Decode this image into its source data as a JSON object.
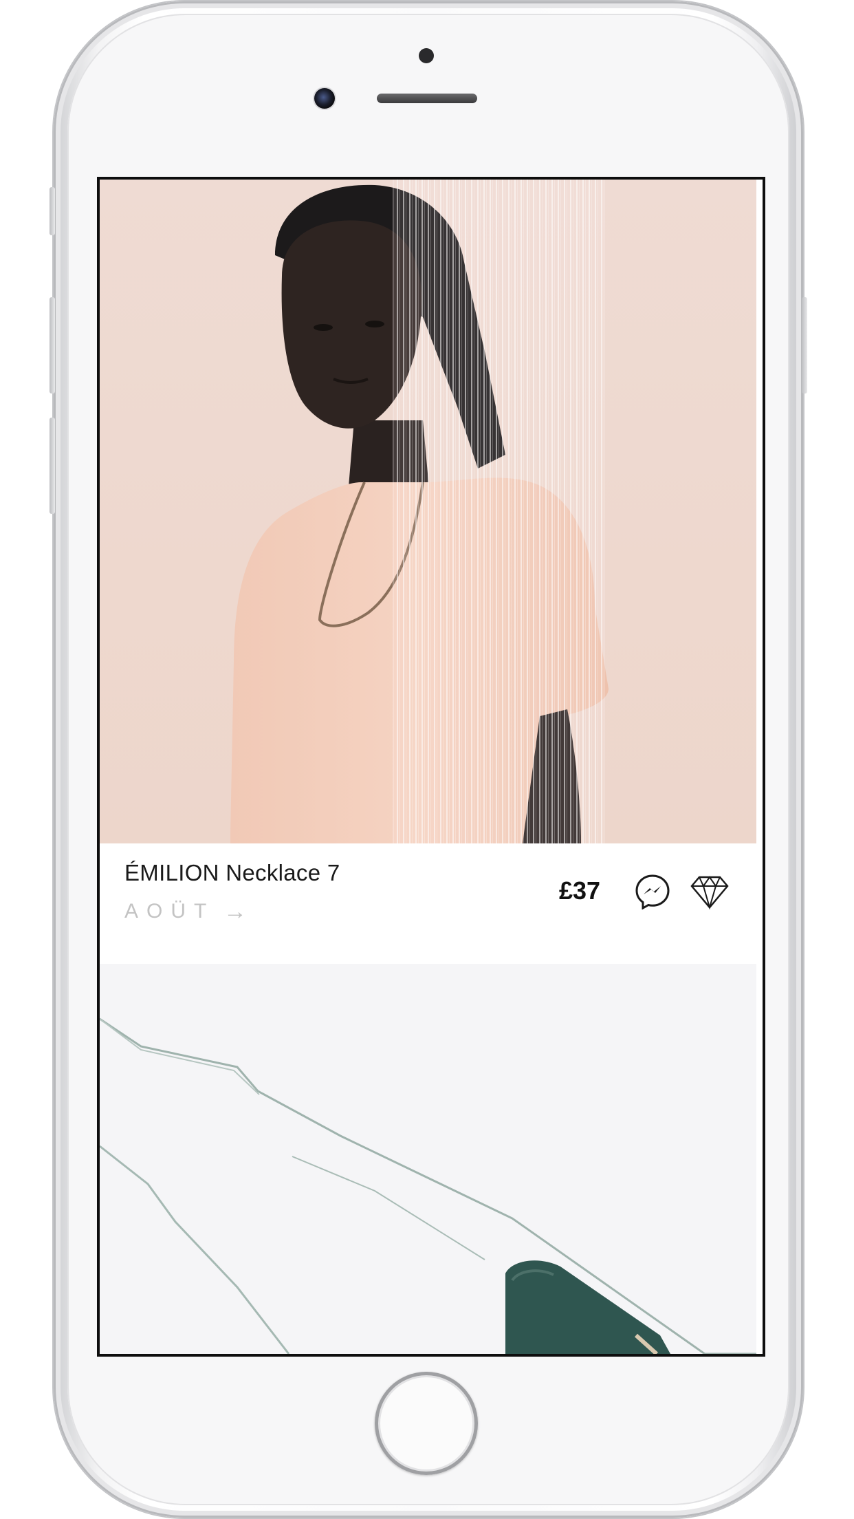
{
  "product": {
    "name": "ÉMILION Necklace 7",
    "brand": "AOÜT",
    "brand_arrow": "→",
    "price": "£37"
  },
  "icons": {
    "share": "messenger-icon",
    "save": "diamond-icon",
    "hero": "model-photo",
    "second": "necklace-photo"
  },
  "colors": {
    "hero_background": "#efd8cf",
    "brand_text": "#c3c3c3",
    "pendant": "#2f5650"
  }
}
